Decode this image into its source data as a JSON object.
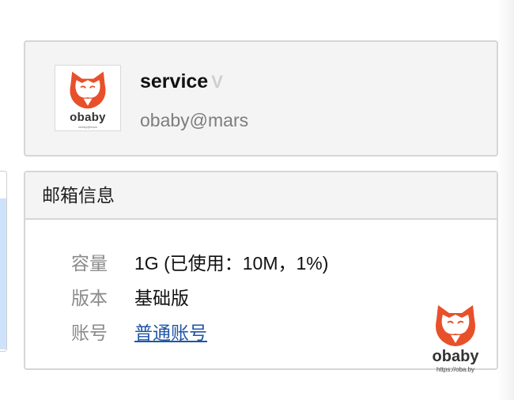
{
  "profile": {
    "avatar_brand": "obaby",
    "avatar_tagline": "obaby@mars",
    "name": "service",
    "badge": "V",
    "address": "obaby@mars"
  },
  "mailbox": {
    "title": "邮箱信息",
    "capacity_label": "容量",
    "capacity_value": "1G (已使用：10M，1%)",
    "version_label": "版本",
    "version_value": "基础版",
    "account_label": "账号",
    "account_value": "普通账号"
  },
  "watermark": {
    "brand": "obaby",
    "url": "https://oba.by"
  },
  "colors": {
    "accent": "#e8502a",
    "link": "#1f55a6",
    "panel_bg": "#f4f4f4",
    "border": "#d6d6d6"
  },
  "icons": {
    "avatar": "fox-logo-icon",
    "badge": "verified-v-icon",
    "watermark": "fox-logo-icon"
  }
}
